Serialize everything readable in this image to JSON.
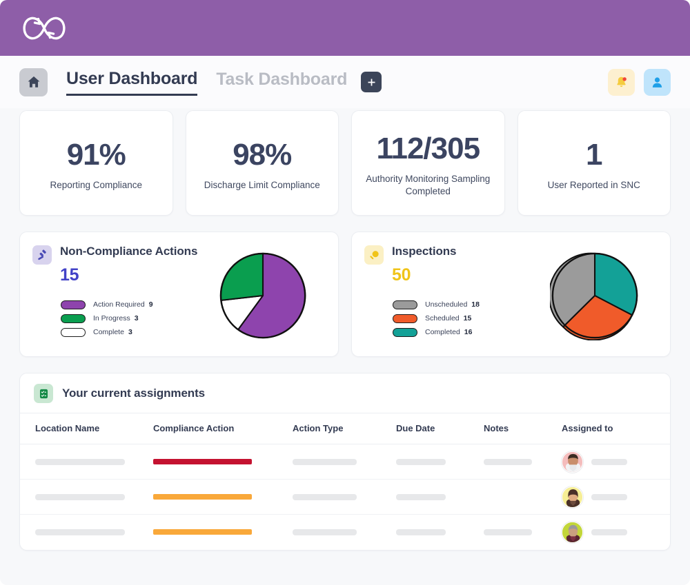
{
  "brand": {
    "logo_icon": "infinity-loop-arrows-logo",
    "color": "#8e5ea8"
  },
  "tabs": {
    "home_icon": "home-icon",
    "items": [
      {
        "label": "User Dashboard",
        "active": true
      },
      {
        "label": "Task Dashboard",
        "active": false
      }
    ],
    "add_label": "+",
    "add_icon": "plus-icon",
    "notifications_icon": "bell-icon",
    "account_icon": "user-icon"
  },
  "kpis": [
    {
      "value": "91%",
      "label": "Reporting Compliance"
    },
    {
      "value": "98%",
      "label": "Discharge Limit Compliance"
    },
    {
      "value": "112/305",
      "label": "Authority Monitoring Sampling Completed"
    },
    {
      "value": "1",
      "label": "User Reported in SNC"
    }
  ],
  "chart_data": [
    {
      "type": "pie",
      "title": "Non-Compliance Actions",
      "icon": "gavel-icon",
      "total": "15",
      "total_color": "#4242c7",
      "categories": [
        "Action Required",
        "In Progress",
        "Complete"
      ],
      "values": [
        9,
        3,
        3
      ],
      "colors": [
        "#8e44ad",
        "#0a9e4f",
        "#ffffff"
      ],
      "legend": "left",
      "start_angle": 0
    },
    {
      "type": "pie",
      "title": "Inspections",
      "icon": "search-icon",
      "total": "50",
      "total_color": "#f0c419",
      "categories": [
        "Unscheduled",
        "Scheduled",
        "Completed"
      ],
      "values": [
        18,
        15,
        16
      ],
      "colors": [
        "#9b9b9b",
        "#f05b2a",
        "#13a197"
      ],
      "legend": "left",
      "start_angle": 0,
      "draw_order": [
        "Completed",
        "Scheduled",
        "Unscheduled"
      ]
    }
  ],
  "assignments": {
    "icon": "checklist-icon",
    "title": "Your current assignments",
    "columns": [
      "Location Name",
      "Compliance Action",
      "Action Type",
      "Due Date",
      "Notes",
      "Assigned to"
    ],
    "rows": [
      {
        "action_bar_color": "#c41230",
        "action_bar_width": 143,
        "avatar": "avatar-person-1",
        "avatar_bg": "#f7c9c9",
        "notes_visible": true
      },
      {
        "action_bar_color": "#f9a83a",
        "action_bar_width": 143,
        "avatar": "avatar-person-2",
        "avatar_bg": "#f7ee9b",
        "notes_visible": false
      },
      {
        "action_bar_color": "#f9a83a",
        "action_bar_width": 143,
        "avatar": "avatar-person-3",
        "avatar_bg": "#c3d63a",
        "notes_visible": true
      }
    ]
  }
}
